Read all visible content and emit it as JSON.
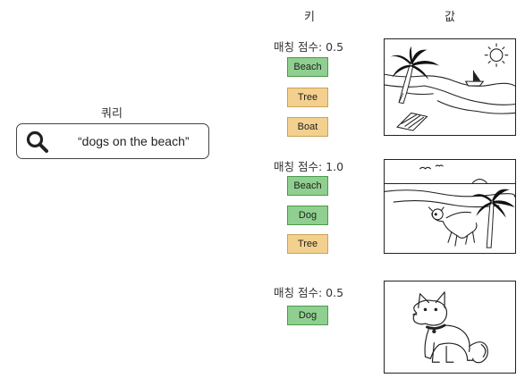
{
  "headers": {
    "key": "키",
    "value": "값"
  },
  "query": {
    "label": "쿼리",
    "text": "“dogs on the beach”"
  },
  "rows": [
    {
      "score": "매칭 점수: 0.5",
      "tags": [
        {
          "label": "Beach",
          "match": true
        },
        {
          "label": "Tree",
          "match": false
        },
        {
          "label": "Boat",
          "match": false
        }
      ]
    },
    {
      "score": "매칭 점수: 1.0",
      "tags": [
        {
          "label": "Beach",
          "match": true
        },
        {
          "label": "Dog",
          "match": true
        },
        {
          "label": "Tree",
          "match": false
        }
      ]
    },
    {
      "score": "매칭 점수: 0.5",
      "tags": [
        {
          "label": "Dog",
          "match": true
        }
      ]
    }
  ],
  "colors": {
    "match": "#8fcf8f",
    "nonmatch": "#f3d08e"
  }
}
